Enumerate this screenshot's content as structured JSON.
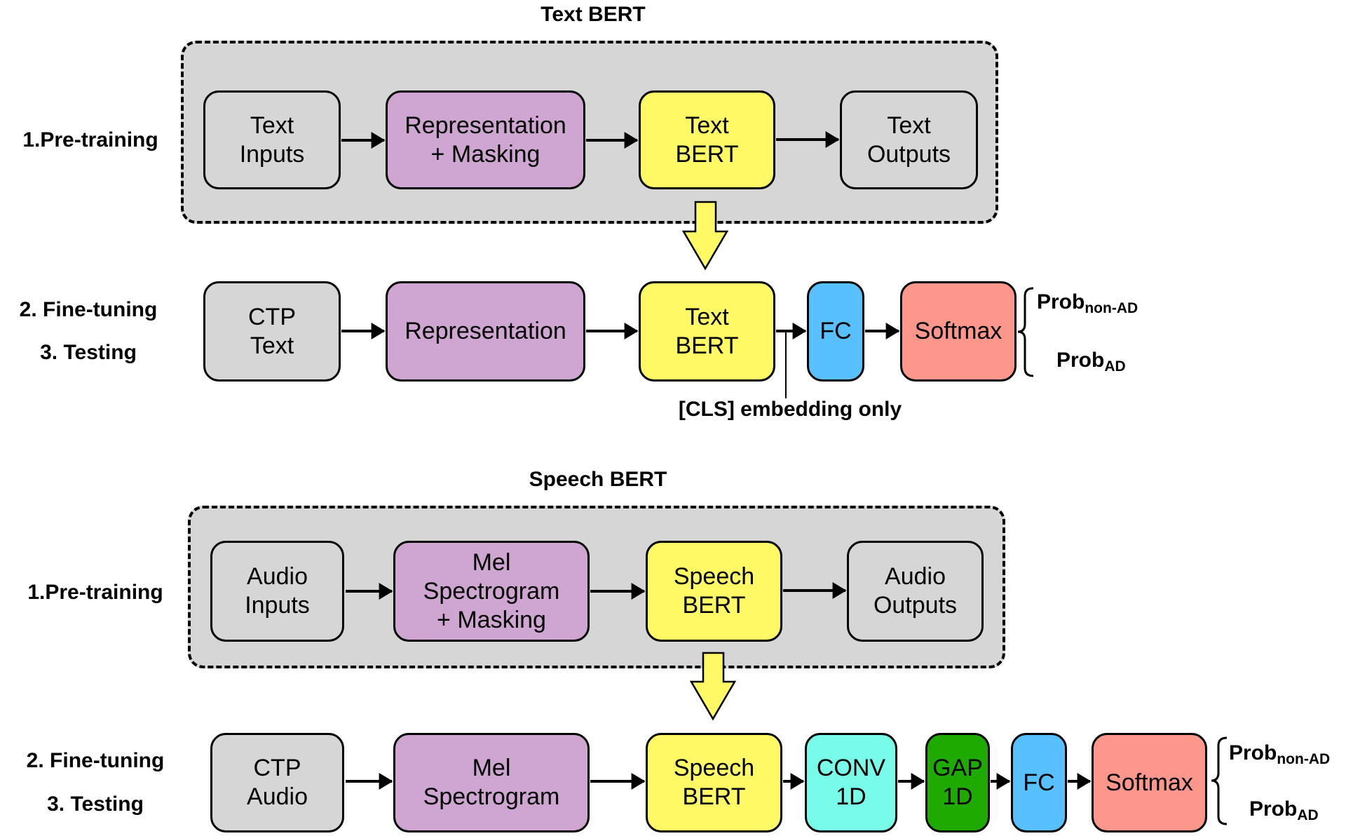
{
  "text_bert": {
    "title": "Text BERT",
    "pretraining": {
      "label": "1.Pre-training",
      "boxes": [
        {
          "lines": [
            "Text",
            "Inputs"
          ],
          "color": "#d6d6d6"
        },
        {
          "lines": [
            "Representation",
            "+ Masking"
          ],
          "color": "#cfa5d2"
        },
        {
          "lines": [
            "Text",
            "BERT"
          ],
          "color": "#fff965"
        },
        {
          "lines": [
            "Text",
            "Outputs"
          ],
          "color": "#d6d6d6"
        }
      ]
    },
    "finetuning": {
      "label_1": "2. Fine-tuning",
      "label_2": "3. Testing",
      "boxes": [
        {
          "lines": [
            "CTP",
            "Text"
          ],
          "color": "#d6d6d6"
        },
        {
          "lines": [
            "Representation"
          ],
          "color": "#cfa5d2"
        },
        {
          "lines": [
            "Text",
            "BERT"
          ],
          "color": "#fff965"
        },
        {
          "lines": [
            "FC"
          ],
          "color": "#58c0ff"
        },
        {
          "lines": [
            "Softmax"
          ],
          "color": "#fd968b"
        }
      ],
      "annotation": "[CLS] embedding only",
      "outputs": {
        "prob_main": "Prob",
        "non_ad_sub": "non-AD",
        "ad_sub": "AD"
      }
    }
  },
  "speech_bert": {
    "title": "Speech BERT",
    "pretraining": {
      "label": "1.Pre-training",
      "boxes": [
        {
          "lines": [
            "Audio",
            "Inputs"
          ],
          "color": "#d6d6d6"
        },
        {
          "lines": [
            "Mel",
            "Spectrogram",
            "+ Masking"
          ],
          "color": "#cfa5d2"
        },
        {
          "lines": [
            "Speech",
            "BERT"
          ],
          "color": "#fff965"
        },
        {
          "lines": [
            "Audio",
            "Outputs"
          ],
          "color": "#d6d6d6"
        }
      ]
    },
    "finetuning": {
      "label_1": "2. Fine-tuning",
      "label_2": "3. Testing",
      "boxes": [
        {
          "lines": [
            "CTP",
            "Audio"
          ],
          "color": "#d6d6d6"
        },
        {
          "lines": [
            "Mel",
            "Spectrogram"
          ],
          "color": "#cfa5d2"
        },
        {
          "lines": [
            "Speech",
            "BERT"
          ],
          "color": "#fff965"
        },
        {
          "lines": [
            "CONV",
            "1D"
          ],
          "color": "#78fbe8"
        },
        {
          "lines": [
            "GAP",
            "1D"
          ],
          "color": "#1eaa00"
        },
        {
          "lines": [
            "FC"
          ],
          "color": "#58c0ff"
        },
        {
          "lines": [
            "Softmax"
          ],
          "color": "#fd968b"
        }
      ],
      "outputs": {
        "prob_main": "Prob",
        "non_ad_sub": "non-AD",
        "ad_sub": "AD"
      }
    }
  }
}
